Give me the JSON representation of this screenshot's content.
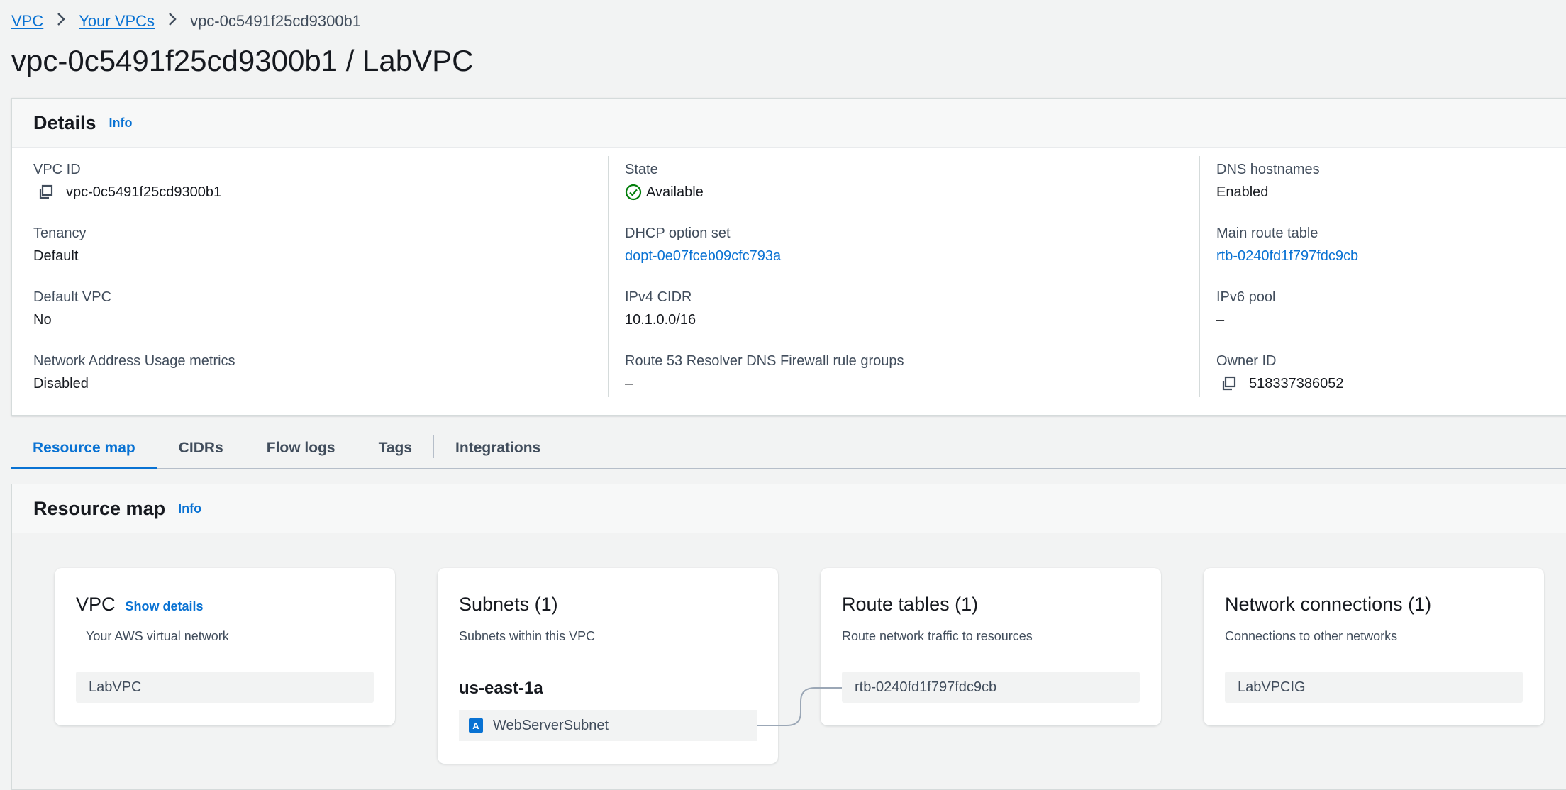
{
  "breadcrumb": {
    "items": [
      "VPC",
      "Your VPCs"
    ],
    "current": "vpc-0c5491f25cd9300b1"
  },
  "page_title": "vpc-0c5491f25cd9300b1 / LabVPC",
  "details": {
    "title": "Details",
    "info": "Info",
    "fields": {
      "vpc_id_label": "VPC ID",
      "vpc_id": "vpc-0c5491f25cd9300b1",
      "tenancy_label": "Tenancy",
      "tenancy": "Default",
      "default_vpc_label": "Default VPC",
      "default_vpc": "No",
      "nau_label": "Network Address Usage metrics",
      "nau": "Disabled",
      "state_label": "State",
      "state": "Available",
      "dhcp_label": "DHCP option set",
      "dhcp": "dopt-0e07fceb09cfc793a",
      "ipv4_label": "IPv4 CIDR",
      "ipv4": "10.1.0.0/16",
      "r53_label": "Route 53 Resolver DNS Firewall rule groups",
      "r53": "–",
      "dns_label": "DNS hostnames",
      "dns": "Enabled",
      "main_rt_label": "Main route table",
      "main_rt": "rtb-0240fd1f797fdc9cb",
      "ipv6_label": "IPv6 pool",
      "ipv6": "–",
      "owner_label": "Owner ID",
      "owner": "518337386052"
    }
  },
  "tabs": [
    "Resource map",
    "CIDRs",
    "Flow logs",
    "Tags",
    "Integrations"
  ],
  "resource_map": {
    "title": "Resource map",
    "info": "Info",
    "vpc_card": {
      "title": "VPC",
      "show_details": "Show details",
      "subtitle": "Your AWS virtual network",
      "item": "LabVPC"
    },
    "subnets_card": {
      "title": "Subnets (1)",
      "subtitle": "Subnets within this VPC",
      "az": "us-east-1a",
      "az_badge": "A",
      "item": "WebServerSubnet"
    },
    "route_card": {
      "title": "Route tables (1)",
      "subtitle": "Route network traffic to resources",
      "item": "rtb-0240fd1f797fdc9cb"
    },
    "net_card": {
      "title": "Network connections (1)",
      "subtitle": "Connections to other networks",
      "item": "LabVPCIG"
    }
  },
  "colors": {
    "link": "#0972d3",
    "success": "#037f0c",
    "text": "#16191f",
    "muted": "#414d5c",
    "background": "#f2f3f3"
  },
  "icons": {
    "copy": "copy-icon",
    "status": "check-circle-icon",
    "separator": "chevron-right-icon"
  }
}
